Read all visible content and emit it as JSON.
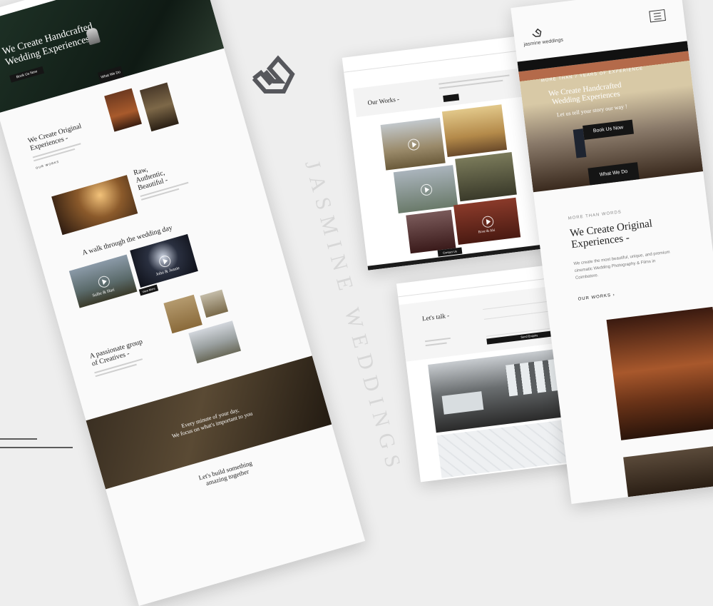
{
  "brand": {
    "name": "jasmine weddings",
    "watermark": "JASMINE WEDDINGS"
  },
  "colors": {
    "background": "#eeeeee",
    "dark": "#151515",
    "logo": "#56575c",
    "forest": "#1f3327"
  },
  "left": {
    "hero_title_1": "We Create Handcrafted",
    "hero_title_2": "Wedding Experiences",
    "hero_cta": "Book Us Now",
    "hero_tab": "What We Do",
    "s1_title_1": "We Create Original",
    "s1_title_2": "Experiences -",
    "s1_link": "OUR WORKS",
    "s2_title_1": "Raw,",
    "s2_title_2": "Authentic,",
    "s2_title_3": "Beautiful -",
    "s3_title": "A walk through the wedding day",
    "couple_1": "Sulbe & Hari",
    "couple_2": "John & Jeanie",
    "view_more": "View More",
    "s4_title_1": "A passionate group",
    "s4_title_2": "of Creatives -",
    "quote_1": "Every minute of your day,",
    "quote_2": "We focus on what's important to you",
    "s5_title_1": "Let's build something",
    "s5_title_2": "amazing together"
  },
  "works": {
    "title": "Our Works -",
    "couple": "Rose & Abi",
    "button": "Contact Us"
  },
  "contact": {
    "title": "Let's talk -",
    "button": "Send Enquiry"
  },
  "mobile": {
    "eyebrow": "MORE THAN 7 YEARS OF EXPERIENCE",
    "hero_title_1": "We Create Handcrafted",
    "hero_title_2": "Wedding Experiences",
    "hero_sub": "Let us tell your story our way !",
    "cta": "Book Us Now",
    "tab": "What We Do",
    "eyebrow2": "MORE THAN WORDS",
    "title_1": "We Create Original",
    "title_2": "Experiences -",
    "body_1": "We create the most beautiful, unique, and premium",
    "body_2": "cinematic Wedding Photography & Films in",
    "body_3": "Coimbatore.",
    "link": "OUR WORKS"
  }
}
